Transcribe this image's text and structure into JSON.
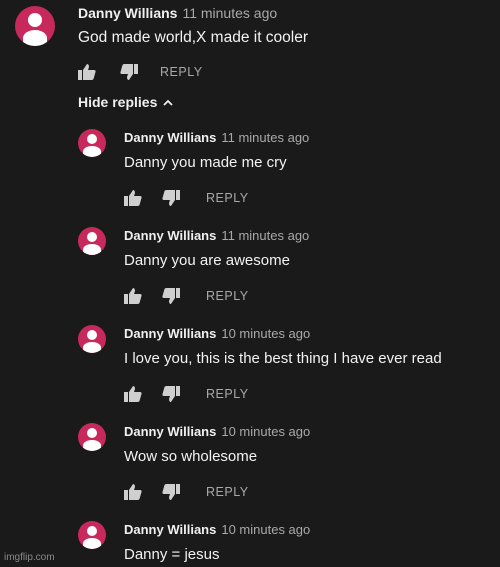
{
  "top_comment": {
    "author": "Danny Willians",
    "time": "11 minutes ago",
    "text": "God made world,X made it cooler",
    "reply_label": "REPLY"
  },
  "hide_replies_label": "Hide replies",
  "replies": [
    {
      "author": "Danny Willians",
      "time": "11 minutes ago",
      "text": "Danny you made me cry",
      "reply_label": "REPLY"
    },
    {
      "author": "Danny Willians",
      "time": "11 minutes ago",
      "text": "Danny you are awesome",
      "reply_label": "REPLY"
    },
    {
      "author": "Danny Willians",
      "time": "10 minutes ago",
      "text": "I love you, this is the best thing I have ever read",
      "reply_label": "REPLY"
    },
    {
      "author": "Danny Willians",
      "time": "10 minutes ago",
      "text": "Wow so wholesome",
      "reply_label": "REPLY"
    },
    {
      "author": "Danny Willians",
      "time": "10 minutes ago",
      "text": "Danny = jesus"
    }
  ],
  "watermark": "imgflip.com",
  "colors": {
    "background": "#1a1a1a",
    "avatar": "#c8295c",
    "secondary_text": "#a9a9a9"
  },
  "icons": [
    "avatar-icon",
    "thumbs-up-icon",
    "thumbs-down-icon",
    "chevron-up-icon"
  ]
}
